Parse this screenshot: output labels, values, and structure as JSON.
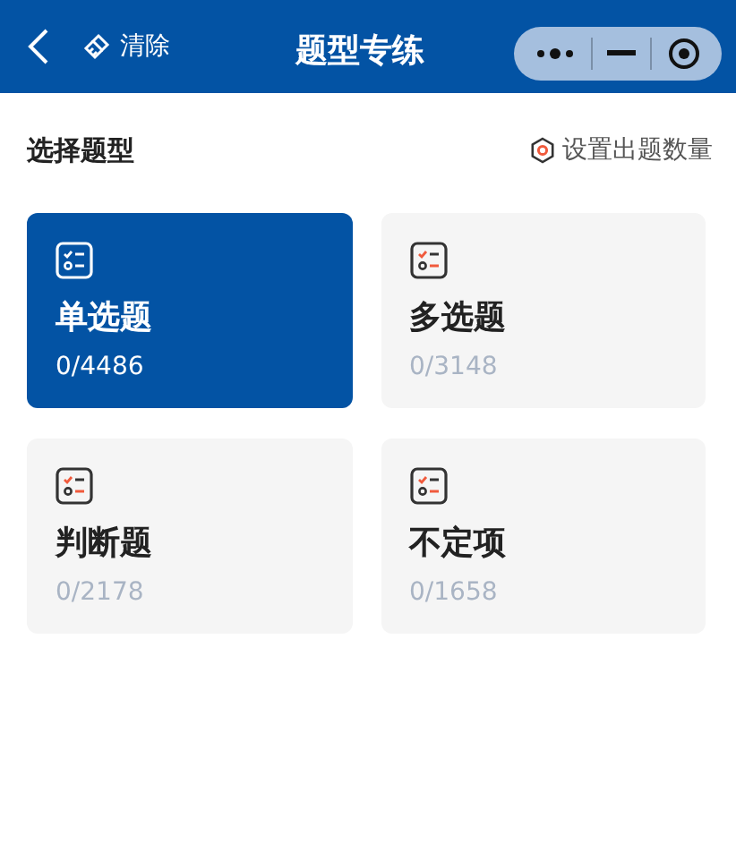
{
  "header": {
    "clear_label": "清除",
    "title": "题型专练"
  },
  "section": {
    "title": "选择题型",
    "settings_link": "设置出题数量"
  },
  "question_types": [
    {
      "name": "单选题",
      "progress": "0/4486",
      "selected": true
    },
    {
      "name": "多选题",
      "progress": "0/3148",
      "selected": false
    },
    {
      "name": "判断题",
      "progress": "0/2178",
      "selected": false
    },
    {
      "name": "不定项",
      "progress": "0/1658",
      "selected": false
    }
  ]
}
